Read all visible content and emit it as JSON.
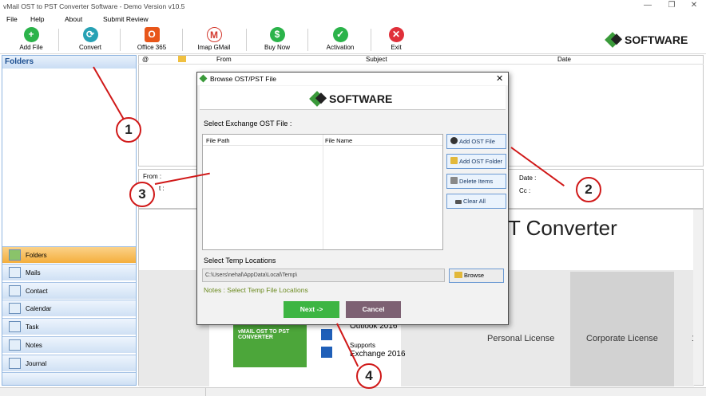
{
  "window": {
    "title": "vMail OST to PST Converter Software - Demo Version v10.5",
    "min_glyph": "—",
    "max_glyph": "❐",
    "close_glyph": "✕"
  },
  "menu": {
    "file": "File",
    "help": "Help",
    "about": "About",
    "submit_review": "Submit Review"
  },
  "toolbar": {
    "add_file": "Add File",
    "convert": "Convert",
    "office365": "Office 365",
    "imap_gmail": "Imap GMail",
    "buy_now": "Buy Now",
    "activation": "Activation",
    "exit": "Exit",
    "brand": "SOFTWARE",
    "colors": {
      "green": "#2bb34a",
      "teal": "#27a1b4",
      "orange": "#e8561a",
      "gmail": "#d33a2f",
      "red": "#e0303a"
    }
  },
  "left_pane": {
    "header": "Folders",
    "nav": [
      "Folders",
      "Mails",
      "Contact",
      "Calendar",
      "Task",
      "Notes",
      "Journal"
    ]
  },
  "grid": {
    "col_from": "From",
    "col_subject": "Subject",
    "col_date": "Date"
  },
  "info": {
    "from_label": "From :",
    "date_label": "Date :",
    "cc_label": "Cc :",
    "subject_partial": "t :"
  },
  "preview": {
    "heading": "T Converter",
    "personal_license": "Personal License",
    "corporate_license": "Corporate License",
    "one": "1",
    "product_box": "vMAIL OST TO PST CONVERTER",
    "outlook": "Outlook 2016",
    "supports": "Supports",
    "exchange": "Exchange 2016"
  },
  "dialog": {
    "title": "Browse OST/PST File",
    "brand": "SOFTWARE",
    "select_label": "Select Exchange OST File :",
    "col_path": "File Path",
    "col_name": "File Name",
    "add_ost_file": "Add OST File",
    "add_ost_folder": "Add OST Folder",
    "delete_items": "Delete Items",
    "clear_all": "Clear All",
    "temp_label": "Select Temp Locations",
    "temp_path": "C:\\Users\\nehal\\AppData\\Local\\Temp\\",
    "browse": "Browse",
    "notes": "Notes : Select Temp File Locations",
    "next": "Next ->",
    "cancel": "Cancel",
    "colors": {
      "next": "#3db543",
      "cancel": "#7d6173",
      "notes": "#6b8a1f"
    }
  },
  "callouts": [
    "1",
    "2",
    "3",
    "4"
  ]
}
